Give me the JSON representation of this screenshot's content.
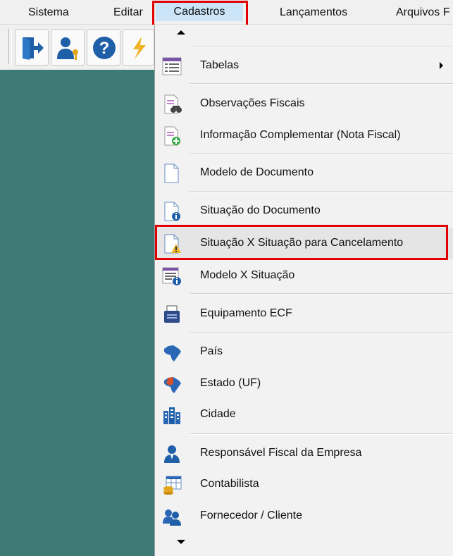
{
  "menubar": {
    "items": [
      "Sistema",
      "Editar",
      "Cadastros",
      "Lançamentos",
      "Arquivos F"
    ]
  },
  "menu": {
    "items": [
      {
        "label": "Tabelas",
        "icon": "table-list-icon"
      },
      {
        "label": "Observações Fiscais",
        "icon": "document-binoculars-icon"
      },
      {
        "label": "Informação Complementar (Nota Fiscal)",
        "icon": "document-add-icon"
      },
      {
        "label": "Modelo de Documento",
        "icon": "blank-document-icon"
      },
      {
        "label": "Situação do Documento",
        "icon": "document-info-icon"
      },
      {
        "label": "Situação X Situação para Cancelamento",
        "icon": "document-warning-icon"
      },
      {
        "label": "Modelo X Situação",
        "icon": "list-info-icon"
      },
      {
        "label": "Equipamento ECF",
        "icon": "fiscal-printer-icon"
      },
      {
        "label": "País",
        "icon": "brazil-map-icon"
      },
      {
        "label": "Estado (UF)",
        "icon": "brazil-state-map-icon"
      },
      {
        "label": "Cidade",
        "icon": "city-buildings-icon"
      },
      {
        "label": "Responsável Fiscal da Empresa",
        "icon": "person-icon"
      },
      {
        "label": "Contabilista",
        "icon": "table-coins-icon"
      },
      {
        "label": "Fornecedor / Cliente",
        "icon": "people-icon"
      }
    ]
  },
  "colors": {
    "highlight_border": "#e00000",
    "workspace": "#3f7a76",
    "menu_active": "#cce4f7"
  }
}
